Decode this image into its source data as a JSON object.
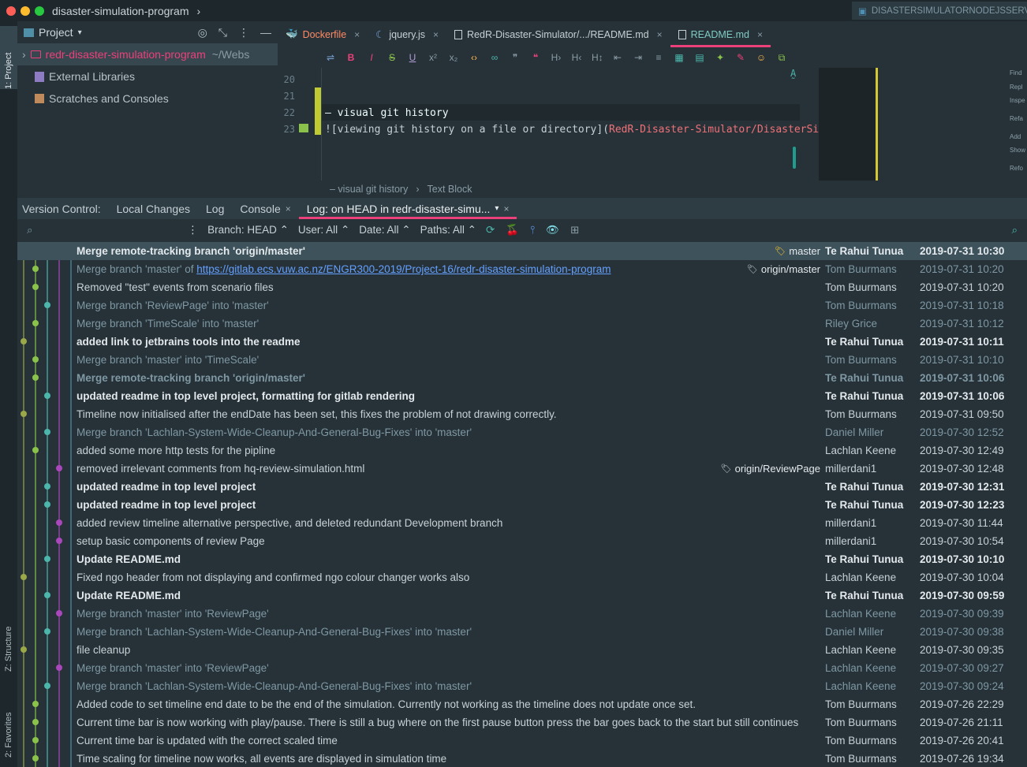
{
  "titlebar": {
    "project_name": "disaster-simulation-program",
    "run_config": "DISASTERSIMULATORNODEJSSERVER"
  },
  "left_strip": {
    "project_tab": "1: Project",
    "structure_tab": "Z: Structure",
    "favorites_tab": "2: Favorites"
  },
  "project_panel": {
    "title": "Project",
    "root_name": "redr-disaster-simulation-program",
    "root_path": "~/Webs",
    "external_libraries": "External Libraries",
    "scratches": "Scratches and Consoles"
  },
  "editor_tabs": [
    {
      "label": "Dockerfile"
    },
    {
      "label": "jquery.js"
    },
    {
      "label": "RedR-Disaster-Simulator/.../README.md"
    },
    {
      "label": "README.md"
    }
  ],
  "editor": {
    "line_numbers": [
      "20",
      "21",
      "22",
      "23"
    ],
    "line22": "– visual git history",
    "line23_a": "![viewing git history on a file or directory](",
    "line23_b": "RedR-Disaster-Simulator/DisasterSimulato",
    "breadcrumb_1": "– visual git history",
    "breadcrumb_2": "Text Block",
    "right_panel": [
      "Find",
      "Repl",
      "Inspe",
      "Refa",
      "Add",
      "Show",
      "Refo"
    ]
  },
  "vc": {
    "label": "Version Control:",
    "tab_local": "Local Changes",
    "tab_log": "Log",
    "tab_console": "Console",
    "tab_active": "Log: on HEAD in redr-disaster-simu..."
  },
  "log_toolbar": {
    "branch": "Branch: HEAD",
    "user": "User: All",
    "date": "Date: All",
    "paths": "Paths: All"
  },
  "commits": [
    {
      "msg": "Merge remote-tracking branch 'origin/master'",
      "ref": "master",
      "author": "Te Rahui Tunua",
      "date": "2019-07-31 10:30",
      "style": "bold"
    },
    {
      "msg": "Merge branch 'master' of ",
      "link": "https://gitlab.ecs.vuw.ac.nz/ENGR300-2019/Project-16/redr-disaster-simulation-program",
      "ref": "origin/master",
      "author": "Tom Buurmans",
      "date": "2019-07-31 10:20",
      "style": "dim"
    },
    {
      "msg": "Removed \"test\" events from scenario files",
      "author": "Tom Buurmans",
      "date": "2019-07-31 10:20",
      "style": "normal"
    },
    {
      "msg": "Merge branch 'ReviewPage' into 'master'",
      "author": "Tom Buurmans",
      "date": "2019-07-31 10:18",
      "style": "dim"
    },
    {
      "msg": "Merge branch 'TimeScale' into 'master'",
      "author": "Riley Grice",
      "date": "2019-07-31 10:12",
      "style": "dim"
    },
    {
      "msg": "added link to jetbrains tools into the readme",
      "author": "Te Rahui Tunua",
      "date": "2019-07-31 10:11",
      "style": "bold"
    },
    {
      "msg": "Merge branch 'master' into 'TimeScale'",
      "author": "Tom Buurmans",
      "date": "2019-07-31 10:10",
      "style": "dim"
    },
    {
      "msg": "Merge remote-tracking branch 'origin/master'",
      "author": "Te Rahui Tunua",
      "date": "2019-07-31 10:06",
      "style": "dimbold"
    },
    {
      "msg": "updated readme in top level project, formatting for gitlab rendering",
      "author": "Te Rahui Tunua",
      "date": "2019-07-31 10:06",
      "style": "bold"
    },
    {
      "msg": "Timeline now initialised after the endDate has been set, this fixes the problem of not drawing correctly.",
      "author": "Tom Buurmans",
      "date": "2019-07-31 09:50",
      "style": "normal"
    },
    {
      "msg": "Merge branch 'Lachlan-System-Wide-Cleanup-And-General-Bug-Fixes' into 'master'",
      "author": "Daniel Miller",
      "date": "2019-07-30 12:52",
      "style": "dim"
    },
    {
      "msg": "added some more http tests for the pipline",
      "author": "Lachlan Keene",
      "date": "2019-07-30 12:49",
      "style": "normal"
    },
    {
      "msg": "removed irrelevant comments from hq-review-simulation.html",
      "ref": "origin/ReviewPage",
      "author": "millerdani1",
      "date": "2019-07-30 12:48",
      "style": "normal"
    },
    {
      "msg": "updated readme in top level project",
      "author": "Te Rahui Tunua",
      "date": "2019-07-30 12:31",
      "style": "bold"
    },
    {
      "msg": "updated readme in top level project",
      "author": "Te Rahui Tunua",
      "date": "2019-07-30 12:23",
      "style": "bold"
    },
    {
      "msg": "added review timeline alternative perspective, and deleted redundant Development branch",
      "author": "millerdani1",
      "date": "2019-07-30 11:44",
      "style": "normal"
    },
    {
      "msg": "setup basic components of review Page",
      "author": "millerdani1",
      "date": "2019-07-30 10:54",
      "style": "normal"
    },
    {
      "msg": "Update README.md",
      "author": "Te Rahui Tunua",
      "date": "2019-07-30 10:10",
      "style": "bold"
    },
    {
      "msg": "Fixed ngo header from not displaying and confirmed ngo colour changer works also",
      "author": "Lachlan Keene",
      "date": "2019-07-30 10:04",
      "style": "normal"
    },
    {
      "msg": "Update README.md",
      "author": "Te Rahui Tunua",
      "date": "2019-07-30 09:59",
      "style": "bold"
    },
    {
      "msg": "Merge branch 'master' into 'ReviewPage'",
      "author": "Lachlan Keene",
      "date": "2019-07-30 09:39",
      "style": "dim"
    },
    {
      "msg": "Merge branch 'Lachlan-System-Wide-Cleanup-And-General-Bug-Fixes' into 'master'",
      "author": "Daniel Miller",
      "date": "2019-07-30 09:38",
      "style": "dim"
    },
    {
      "msg": "file cleanup",
      "author": "Lachlan Keene",
      "date": "2019-07-30 09:35",
      "style": "normal"
    },
    {
      "msg": "Merge branch 'master' into 'ReviewPage'",
      "author": "Lachlan Keene",
      "date": "2019-07-30 09:27",
      "style": "dim"
    },
    {
      "msg": "Merge branch 'Lachlan-System-Wide-Cleanup-And-General-Bug-Fixes' into 'master'",
      "author": "Lachlan Keene",
      "date": "2019-07-30 09:24",
      "style": "dim"
    },
    {
      "msg": "Added code to set timeline end date to be the end of the simulation. Currently not working as the timeline does not update once set.",
      "author": "Tom Buurmans",
      "date": "2019-07-26 22:29",
      "style": "normal"
    },
    {
      "msg": "Current time bar is now working with play/pause. There is still a bug where on the first pause button press the bar goes back to the start but still continues",
      "author": "Tom Buurmans",
      "date": "2019-07-26 21:11",
      "style": "normal"
    },
    {
      "msg": "Current time bar is updated with the correct scaled time",
      "author": "Tom Buurmans",
      "date": "2019-07-26 20:41",
      "style": "normal"
    },
    {
      "msg": "Time scaling for timeline now works, all events are displayed in simulation time",
      "author": "Tom Buurmans",
      "date": "2019-07-26 19:34",
      "style": "normal"
    }
  ],
  "colors": {
    "accent_pink": "#ec407a",
    "teal": "#80cbc4",
    "graph_green": "#8bc34a",
    "graph_olive": "#9aa84a",
    "graph_teal": "#4db6ac",
    "graph_purple": "#ab47bc",
    "graph_blue": "#4f8fa8"
  }
}
